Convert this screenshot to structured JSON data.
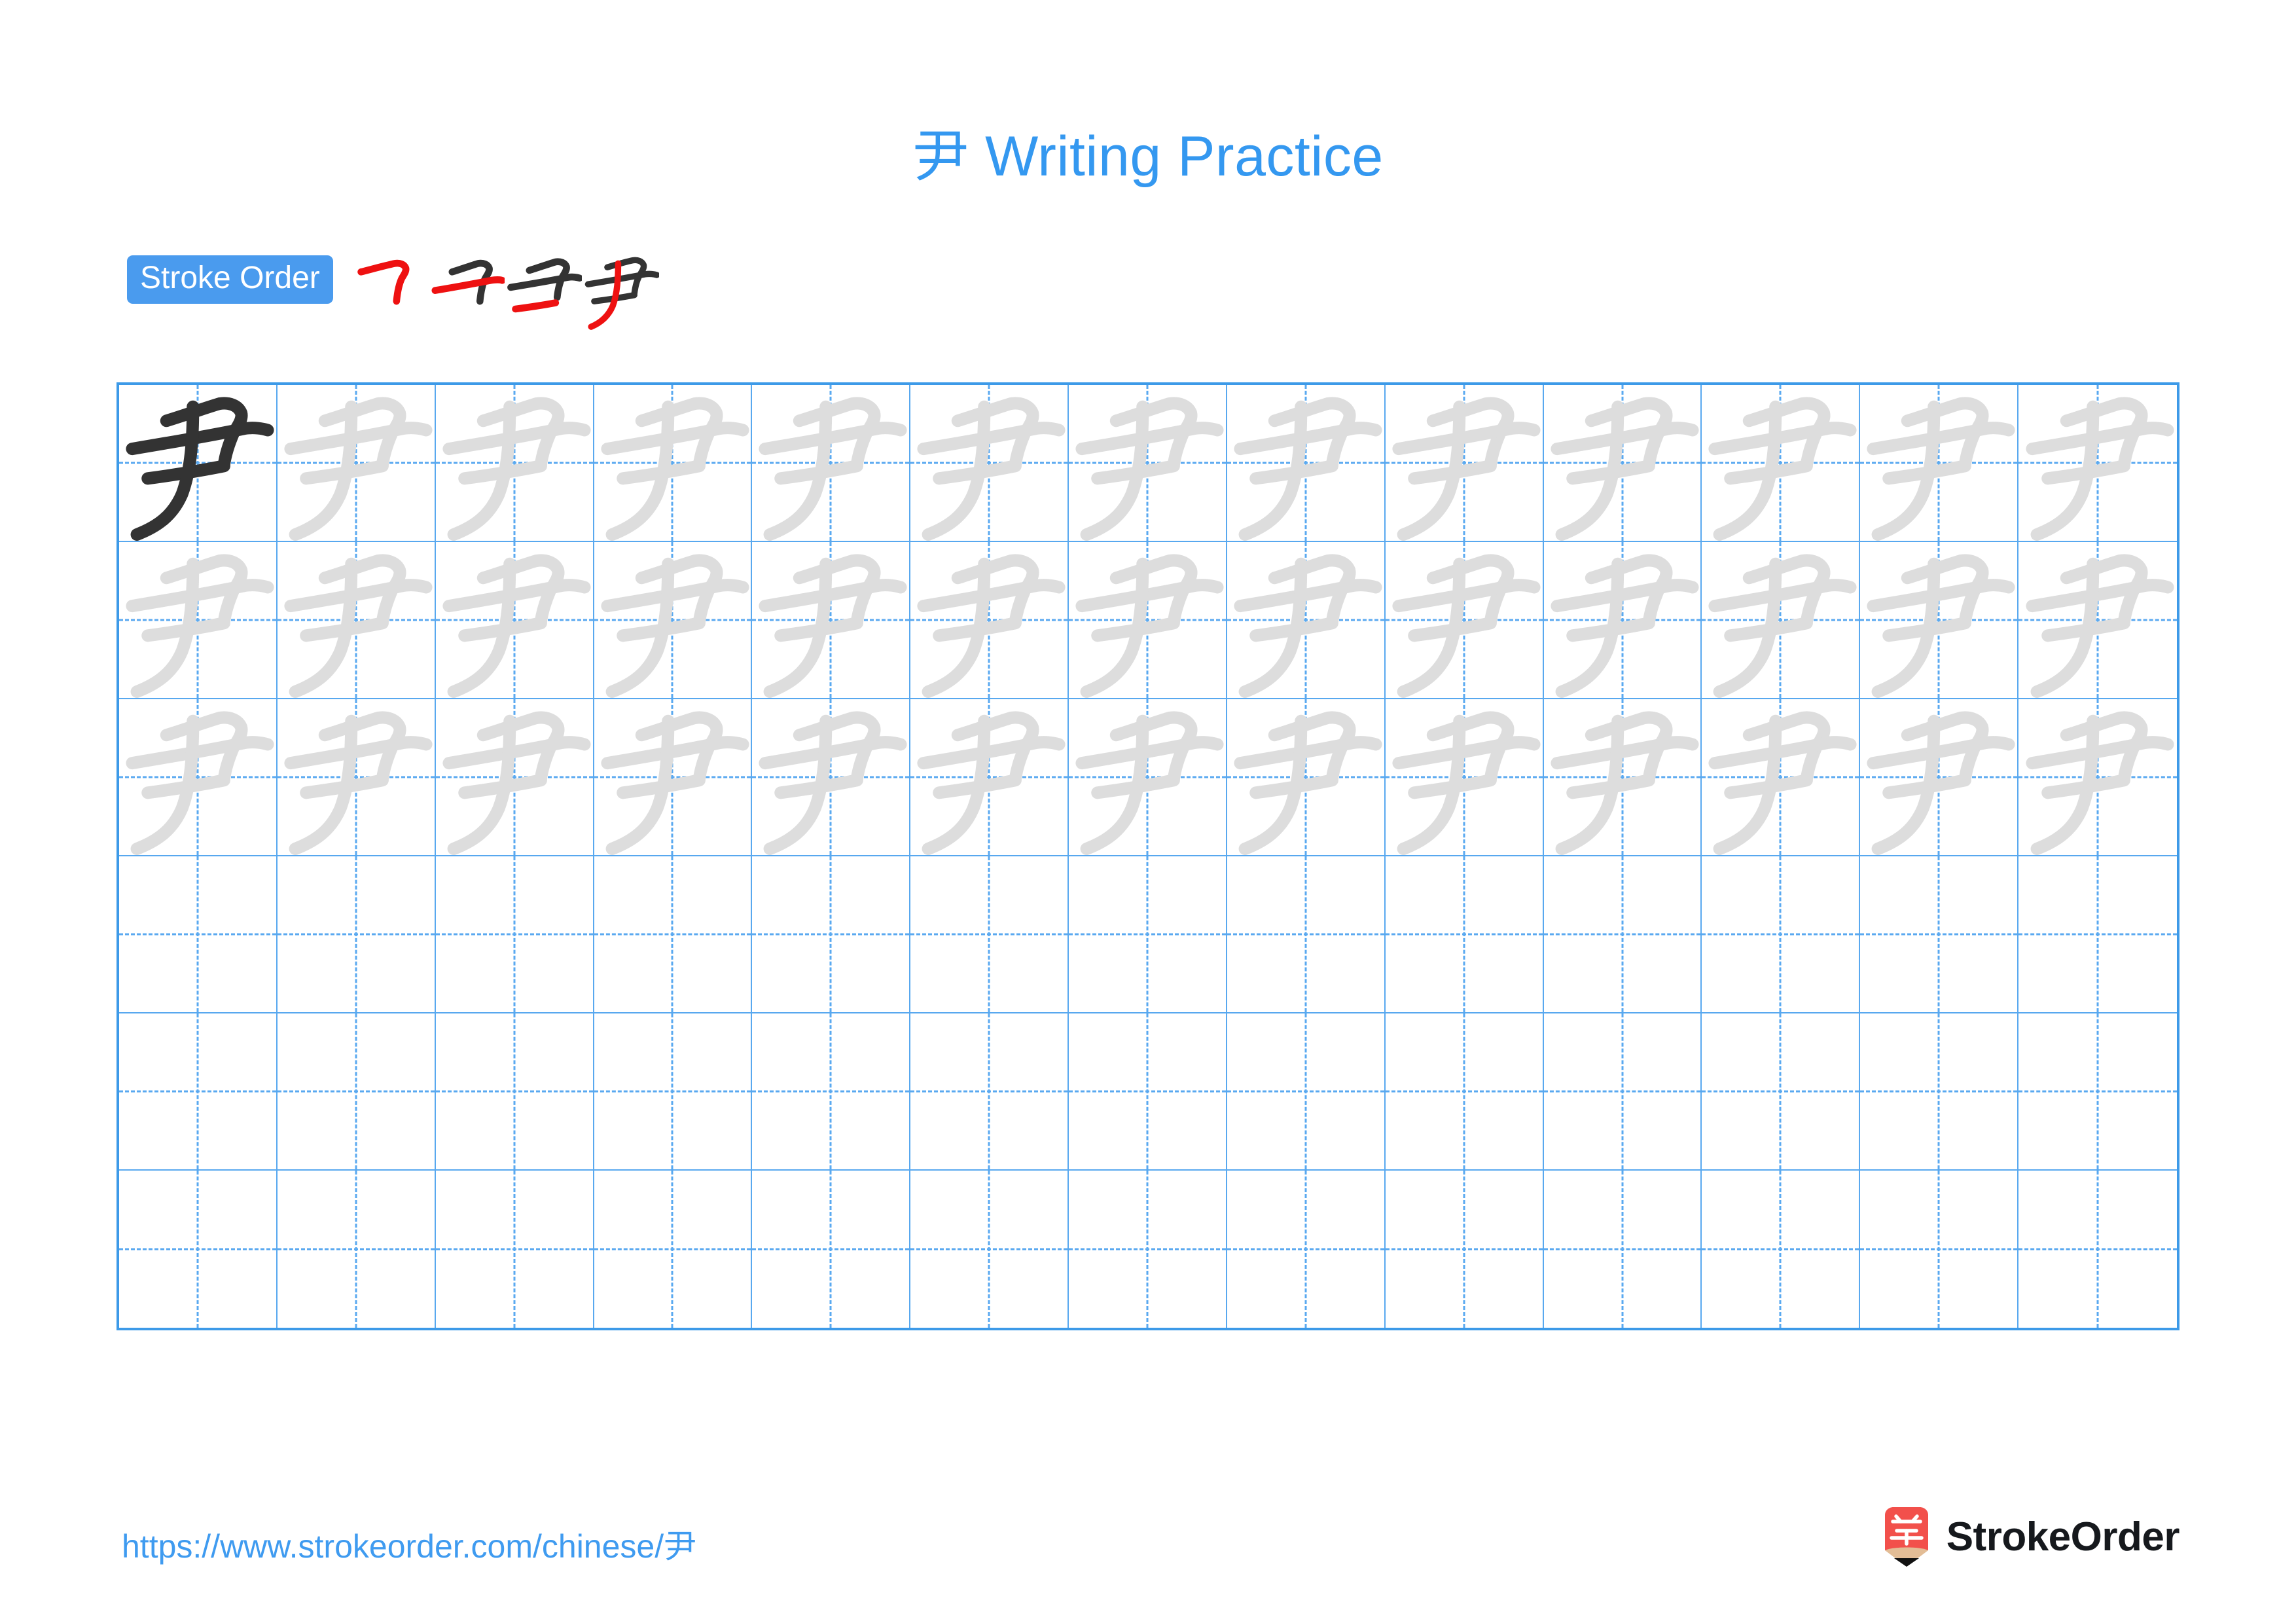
{
  "page": {
    "title_character": "尹",
    "title_suffix": " Writing Practice",
    "title_full": "尹 Writing Practice",
    "title_color": "#3498f0",
    "background_color": "#ffffff"
  },
  "stroke_order": {
    "badge_label": "Stroke Order",
    "badge_bg_color": "#4a9bee",
    "badge_text_color": "#ffffff",
    "new_stroke_color": "#ee1111",
    "old_stroke_color": "#333333",
    "stroke_count": 4,
    "steps": [
      {
        "index": 1,
        "name": "stroke-step-1",
        "strokes_shown": 1,
        "new_stroke": "horizontal-bend-hook"
      },
      {
        "index": 2,
        "name": "stroke-step-2",
        "strokes_shown": 2,
        "new_stroke": "horizontal"
      },
      {
        "index": 3,
        "name": "stroke-step-3",
        "strokes_shown": 3,
        "new_stroke": "horizontal"
      },
      {
        "index": 4,
        "name": "stroke-step-4",
        "strokes_shown": 4,
        "new_stroke": "left-falling-curve"
      }
    ]
  },
  "grid": {
    "columns": 13,
    "rows": 6,
    "line_color": "#58a8ef",
    "border_color": "#3d9ae8",
    "guide_line_color": "#5aa9f0",
    "solid_glyph_color": "#333333",
    "trace_glyph_color": "#dddddd",
    "character": "尹",
    "rows_data": [
      {
        "row": 1,
        "cells": [
          "solid",
          "trace",
          "trace",
          "trace",
          "trace",
          "trace",
          "trace",
          "trace",
          "trace",
          "trace",
          "trace",
          "trace",
          "trace"
        ]
      },
      {
        "row": 2,
        "cells": [
          "trace",
          "trace",
          "trace",
          "trace",
          "trace",
          "trace",
          "trace",
          "trace",
          "trace",
          "trace",
          "trace",
          "trace",
          "trace"
        ]
      },
      {
        "row": 3,
        "cells": [
          "trace",
          "trace",
          "trace",
          "trace",
          "trace",
          "trace",
          "trace",
          "trace",
          "trace",
          "trace",
          "trace",
          "trace",
          "trace"
        ]
      },
      {
        "row": 4,
        "cells": [
          "empty",
          "empty",
          "empty",
          "empty",
          "empty",
          "empty",
          "empty",
          "empty",
          "empty",
          "empty",
          "empty",
          "empty",
          "empty"
        ]
      },
      {
        "row": 5,
        "cells": [
          "empty",
          "empty",
          "empty",
          "empty",
          "empty",
          "empty",
          "empty",
          "empty",
          "empty",
          "empty",
          "empty",
          "empty",
          "empty"
        ]
      },
      {
        "row": 6,
        "cells": [
          "empty",
          "empty",
          "empty",
          "empty",
          "empty",
          "empty",
          "empty",
          "empty",
          "empty",
          "empty",
          "empty",
          "empty",
          "empty"
        ]
      }
    ]
  },
  "footer": {
    "url": "https://www.strokeorder.com/chinese/尹",
    "url_color": "#3f9bf0",
    "brand_name": "StrokeOrder",
    "brand_text_color": "#16191d",
    "logo_character": "字",
    "logo_bg_color": "#f2504b",
    "logo_tip_color": "#e3bd96"
  }
}
